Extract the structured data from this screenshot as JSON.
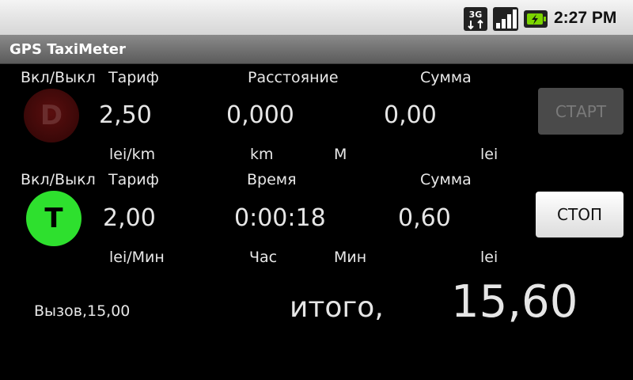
{
  "status_bar": {
    "network_type": "3G",
    "clock": "2:27 PM",
    "icons": [
      "3g-icon",
      "signal-icon",
      "battery-charging-icon"
    ]
  },
  "app": {
    "title": "GPS TaxiMeter"
  },
  "distance_row": {
    "onoff_label": "Вкл/Выкл",
    "tariff_label": "Тариф",
    "distance_label": "Расстояние",
    "sum_label": "Сумма",
    "indicator": "D",
    "tariff_value": "2,50",
    "distance_value": "0,000",
    "sum_value": "0,00",
    "start_label": "СТАРТ",
    "unit_tariff": "lei/km",
    "unit_km": "km",
    "unit_m": "M",
    "unit_sum": "lei"
  },
  "time_row": {
    "onoff_label": "Вкл/Выкл",
    "tariff_label": "Тариф",
    "time_label": "Время",
    "sum_label": "Сумма",
    "indicator": "T",
    "tariff_value": "2,00",
    "time_value": "0:00:18",
    "sum_value": "0,60",
    "stop_label": "СТОП",
    "unit_tariff": "lei/Мин",
    "unit_hour": "Час",
    "unit_min": "Мин",
    "unit_sum": "lei"
  },
  "footer": {
    "call_label": "Вызов,15,00",
    "total_label": "итого,",
    "total_value": "15,60"
  },
  "colors": {
    "indicator_d": "#3a0808",
    "indicator_t": "#2ee02e",
    "start_button": "#4a4a4a",
    "stop_button": "#ffffff"
  }
}
